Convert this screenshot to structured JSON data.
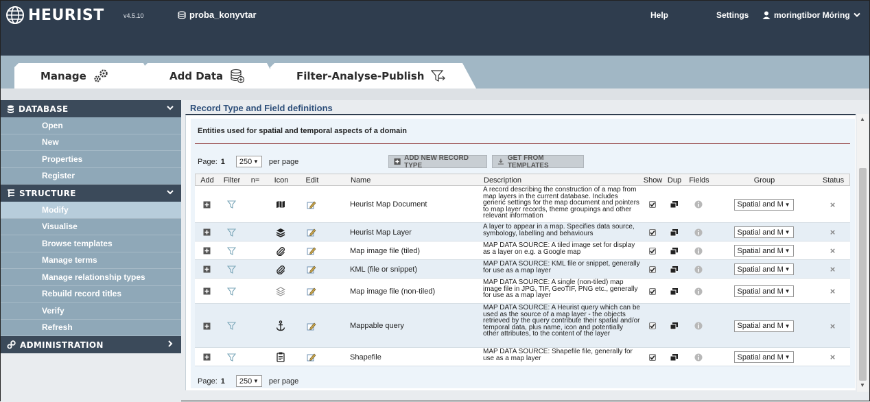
{
  "header": {
    "app_name": "HEURIST",
    "version": "v4.5.10",
    "database": "proba_konyvtar",
    "help": "Help",
    "settings": "Settings",
    "user": "moringtibor Móring"
  },
  "tabs": [
    {
      "label": "Manage"
    },
    {
      "label": "Add Data"
    },
    {
      "label": "Filter-Analyse-Publish"
    }
  ],
  "sidebar": {
    "database": {
      "title": "DATABASE",
      "items": [
        "Open",
        "New",
        "Properties",
        "Register"
      ]
    },
    "structure": {
      "title": "STRUCTURE",
      "items": [
        "Modify",
        "Visualise",
        "Browse templates",
        "Manage terms",
        "Manage relationship types",
        "Rebuild record titles",
        "Verify",
        "Refresh"
      ],
      "active": "Modify"
    },
    "administration": {
      "title": "ADMINISTRATION"
    }
  },
  "main": {
    "title": "Record Type and Field definitions",
    "entities": "Entities used for spatial and temporal aspects of a domain",
    "page_label": "Page:",
    "page_number": "1",
    "per_page_value": "250",
    "per_page_label": "per page",
    "add_record_type": "ADD NEW RECORD TYPE",
    "get_templates": "GET FROM TEMPLATES"
  },
  "columns": [
    "Add",
    "Filter",
    "n=",
    "Icon",
    "Edit",
    "Name",
    "Description",
    "Show",
    "Dup",
    "Fields",
    "Group",
    "Status"
  ],
  "rows": [
    {
      "icon": "map-document-icon",
      "name": "Heurist Map Document",
      "description": "A record describing the construction of a map from map layers in the current database. Includes generic settings for the map document and pointers to map layer records, theme groupings and other relevant information",
      "group": "Spatial and M"
    },
    {
      "icon": "layers-icon",
      "name": "Heurist Map Layer",
      "description": "A layer to appear in a map. Specifies data source, symbology, labelling and behaviours",
      "group": "Spatial and M"
    },
    {
      "icon": "paperclip-icon",
      "name": "Map image file (tiled)",
      "description": "MAP DATA SOURCE: A tiled image set for display as a layer on e.g. a Google map",
      "group": "Spatial and M"
    },
    {
      "icon": "paperclip-icon",
      "name": "KML (file or snippet)",
      "description": "MAP DATA SOURCE: KML file or snippet, generally for use as a map layer",
      "group": "Spatial and M"
    },
    {
      "icon": "layers-outline-icon",
      "name": "Map image file (non-tiled)",
      "description": "MAP DATA SOURCE: A single (non-tiled) map image file in JPG, TIF, GeoTIF, PNG etc., generally for use as a map layer",
      "group": "Spatial and M"
    },
    {
      "icon": "anchor-icon",
      "name": "Mappable query",
      "description": "MAP DATA SOURCE: A Heurist query which can be used as the source of a map layer - the objects retrieved by the query contribute their spatial and/or temporal data, plus name, icon and potentially other attributes, to the content of the layer",
      "group": "Spatial and M"
    },
    {
      "icon": "clipboard-icon",
      "name": "Shapefile",
      "description": "MAP DATA SOURCE: Shapefile file, generally for use as a map layer",
      "group": "Spatial and M"
    }
  ]
}
